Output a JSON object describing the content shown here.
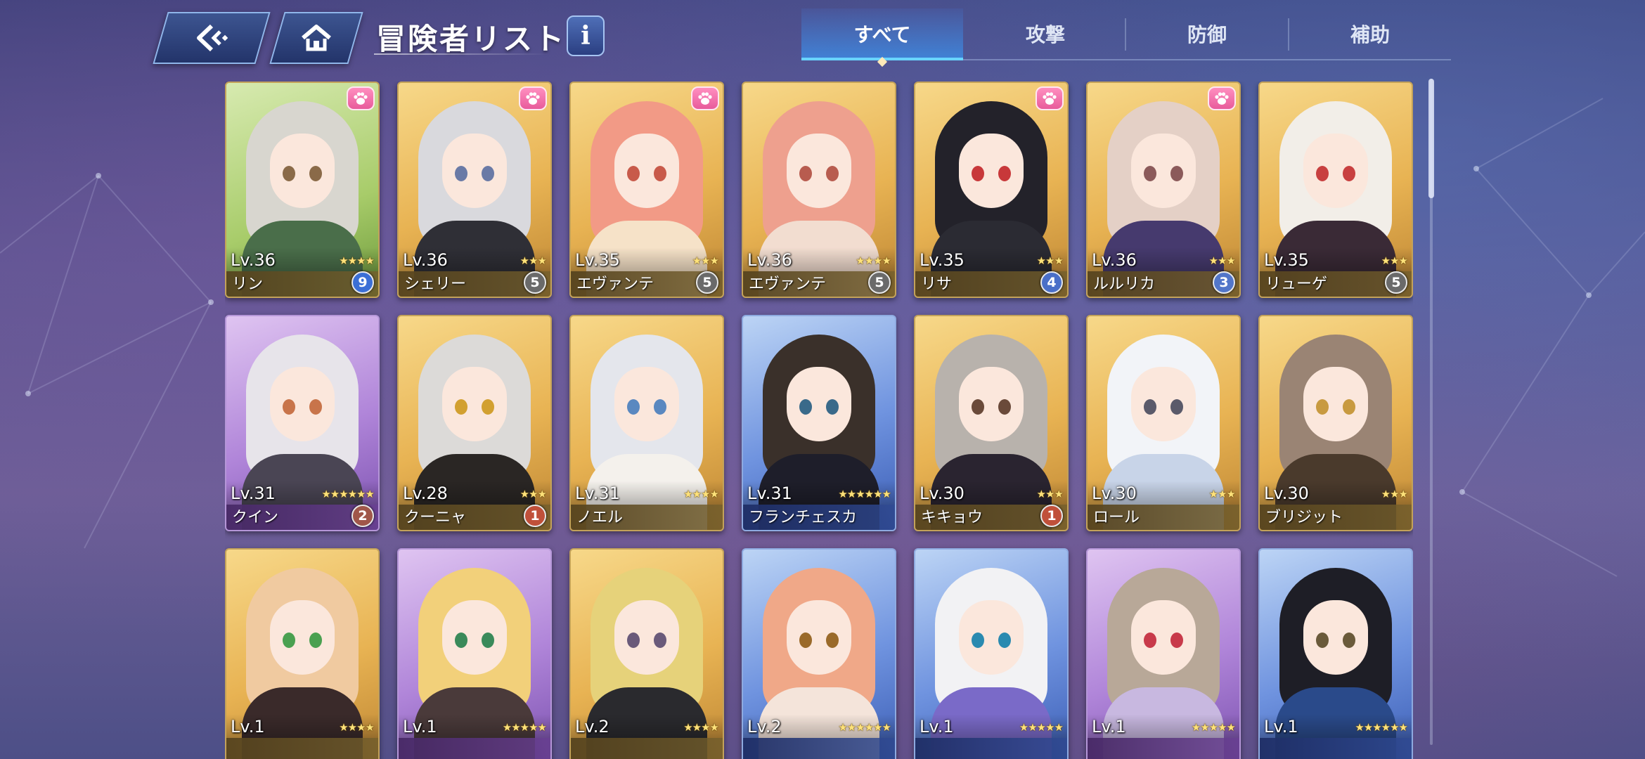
{
  "header": {
    "title": "冒険者リスト",
    "back_icon": "back-arrow-icon",
    "home_icon": "home-icon",
    "info_label": "i"
  },
  "tabs": [
    {
      "label": "すべて",
      "active": true
    },
    {
      "label": "攻撃",
      "active": false
    },
    {
      "label": "防御",
      "active": false
    },
    {
      "label": "補助",
      "active": false
    }
  ],
  "colors": {
    "accent": "#69d4ff",
    "card_gold": "#e8b353",
    "card_purple": "#b085d9",
    "card_blue": "#6f93df",
    "card_green": "#a8cc6a",
    "star": "#ffe27a",
    "paw_badge": "#e85b9b"
  },
  "cards": [
    {
      "level": "Lv.36",
      "name": "リン",
      "stars": 4,
      "badge": "9",
      "badge_color": "#3b6fd6",
      "paw": true,
      "rarity": "green",
      "hair": "#d8d6cf",
      "eyes": "#8a6a48",
      "outfit": "#4a6e4a"
    },
    {
      "level": "Lv.36",
      "name": "シェリー",
      "stars": 3,
      "badge": "5",
      "badge_color": "#6a6a6a",
      "paw": true,
      "rarity": "gold",
      "hair": "#d9d9dd",
      "eyes": "#6a7aa6",
      "outfit": "#2f2f36"
    },
    {
      "level": "Lv.35",
      "name": "エヴァンテ",
      "stars": 3,
      "badge": "5",
      "badge_color": "#6a6a6a",
      "paw": true,
      "rarity": "gold",
      "hair": "#f29a86",
      "eyes": "#c85a4a",
      "outfit": "#f6e2c8"
    },
    {
      "level": "Lv.36",
      "name": "エヴァンテ",
      "stars": 4,
      "badge": "5",
      "badge_color": "#6a6a6a",
      "paw": false,
      "rarity": "gold",
      "hair": "#eea08e",
      "eyes": "#b85c4f",
      "outfit": "#f2ddd0"
    },
    {
      "level": "Lv.35",
      "name": "リサ",
      "stars": 3,
      "badge": "4",
      "badge_color": "#4a6fc8",
      "paw": true,
      "rarity": "gold",
      "hair": "#23222a",
      "eyes": "#c8383a",
      "outfit": "#2b2b33"
    },
    {
      "level": "Lv.36",
      "name": "ルルリカ",
      "stars": 3,
      "badge": "3",
      "badge_color": "#5276c9",
      "paw": true,
      "rarity": "gold",
      "hair": "#e4d0c6",
      "eyes": "#8b5a5a",
      "outfit": "#463a6e"
    },
    {
      "level": "Lv.35",
      "name": "リューゲ",
      "stars": 3,
      "badge": "5",
      "badge_color": "#6a6a6a",
      "paw": false,
      "rarity": "gold",
      "hair": "#f2eee8",
      "eyes": "#c84040",
      "outfit": "#3a2a36"
    },
    {
      "level": "Lv.31",
      "name": "クイン",
      "stars": 6,
      "badge": "2",
      "badge_color": "#a0574a",
      "paw": false,
      "rarity": "purple",
      "hair": "#e7e4ea",
      "eyes": "#c8744a",
      "outfit": "#4a4554"
    },
    {
      "level": "Lv.28",
      "name": "クーニャ",
      "stars": 3,
      "badge": "1",
      "badge_color": "#c0503a",
      "paw": false,
      "rarity": "gold",
      "hair": "#dcdad8",
      "eyes": "#d2a030",
      "outfit": "#2a2624"
    },
    {
      "level": "Lv.31",
      "name": "ノエル",
      "stars": 4,
      "badge": "",
      "badge_color": "",
      "paw": false,
      "rarity": "gold",
      "hair": "#e4e6ec",
      "eyes": "#5a88c0",
      "outfit": "#f4f1ec"
    },
    {
      "level": "Lv.31",
      "name": "フランチェスカ",
      "stars": 6,
      "badge": "",
      "badge_color": "",
      "paw": false,
      "rarity": "blue",
      "hair": "#3a302a",
      "eyes": "#3a6a8a",
      "outfit": "#1e1e2a"
    },
    {
      "level": "Lv.30",
      "name": "キキョウ",
      "stars": 3,
      "badge": "1",
      "badge_color": "#c0503a",
      "paw": false,
      "rarity": "gold",
      "hair": "#b8b2ac",
      "eyes": "#6a4a3a",
      "outfit": "#2a2430"
    },
    {
      "level": "Lv.30",
      "name": "ロール",
      "stars": 3,
      "badge": "",
      "badge_color": "",
      "paw": false,
      "rarity": "gold",
      "hair": "#f2f4f8",
      "eyes": "#5a5a6a",
      "outfit": "#c8d4e8"
    },
    {
      "level": "Lv.30",
      "name": "ブリジット",
      "stars": 3,
      "badge": "",
      "badge_color": "",
      "paw": false,
      "rarity": "gold",
      "hair": "#9a8474",
      "eyes": "#c89a40",
      "outfit": "#4a3a2c"
    },
    {
      "level": "Lv.1",
      "name": "",
      "stars": 4,
      "badge": "",
      "badge_color": "",
      "paw": false,
      "rarity": "gold",
      "hair": "#f0caa0",
      "eyes": "#4aa050",
      "outfit": "#3a2a2a"
    },
    {
      "level": "Lv.1",
      "name": "",
      "stars": 5,
      "badge": "",
      "badge_color": "",
      "paw": false,
      "rarity": "purple",
      "hair": "#f2d07a",
      "eyes": "#3a8a5a",
      "outfit": "#4a3a3a"
    },
    {
      "level": "Lv.2",
      "name": "",
      "stars": 4,
      "badge": "",
      "badge_color": "",
      "paw": false,
      "rarity": "gold",
      "hair": "#e6d27a",
      "eyes": "#6a5a7a",
      "outfit": "#2a2a2e"
    },
    {
      "level": "Lv.2",
      "name": "",
      "stars": 6,
      "badge": "",
      "badge_color": "",
      "paw": false,
      "rarity": "blue",
      "hair": "#f0a888",
      "eyes": "#9a6a2a",
      "outfit": "#f4e4da"
    },
    {
      "level": "Lv.1",
      "name": "",
      "stars": 5,
      "badge": "",
      "badge_color": "",
      "paw": false,
      "rarity": "blue",
      "hair": "#f2f2f4",
      "eyes": "#2a8ab0",
      "outfit": "#7a6ac8"
    },
    {
      "level": "Lv.1",
      "name": "",
      "stars": 5,
      "badge": "",
      "badge_color": "",
      "paw": false,
      "rarity": "purple",
      "hair": "#b8a898",
      "eyes": "#c83a4a",
      "outfit": "#c8b8e0"
    },
    {
      "level": "Lv.1",
      "name": "",
      "stars": 6,
      "badge": "",
      "badge_color": "",
      "paw": false,
      "rarity": "blue",
      "hair": "#1e1e26",
      "eyes": "#6a5a3a",
      "outfit": "#2a4a8a"
    }
  ]
}
